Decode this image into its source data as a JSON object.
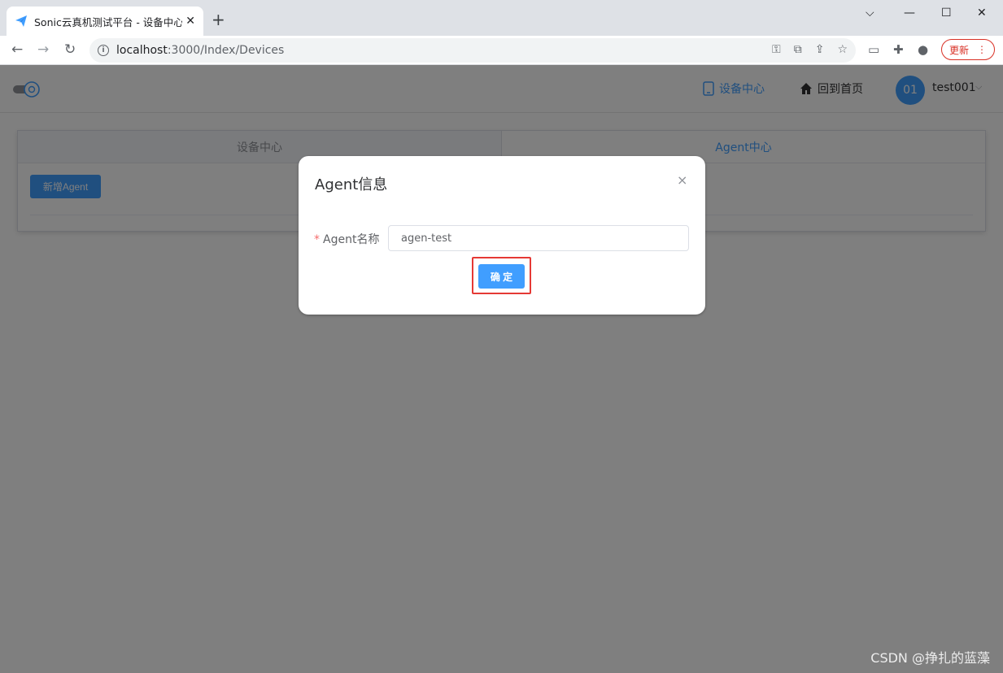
{
  "browser": {
    "tab_title": "Sonic云真机测试平台 - 设备中心",
    "tab_close": "✕",
    "new_tab": "+",
    "url_host": "localhost",
    "url_path": ":3000/Index/Devices",
    "update_label": "更新",
    "update_menu": "⋮"
  },
  "header": {
    "nav_devices": "设备中心",
    "nav_home": "回到首页",
    "avatar_text": "01",
    "username": "test001"
  },
  "card": {
    "tabs": [
      {
        "label": "设备中心"
      },
      {
        "label": "Agent中心"
      }
    ],
    "add_button": "新增Agent"
  },
  "dialog": {
    "title": "Agent信息",
    "close": "×",
    "field_required": "*",
    "field_label": "Agent名称",
    "field_value": "agen-test",
    "confirm": "确 定"
  },
  "watermark": "CSDN @挣扎的蓝藻",
  "colors": {
    "primary": "#409eff",
    "highlight_border": "#e53935",
    "mask": "rgba(0,0,0,0.5)"
  }
}
